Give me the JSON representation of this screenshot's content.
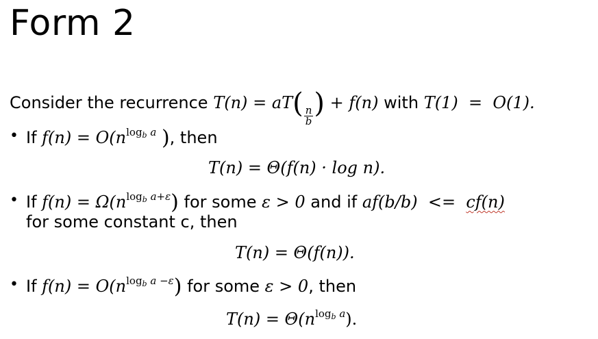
{
  "title": "Form 2",
  "intro": {
    "prefix": "Consider the recurrence",
    "recurrence_lhs": "T(n)",
    "eq": "=",
    "a": "a",
    "T": "T",
    "frac_num": "n",
    "frac_den": "b",
    "plus_f": "+ f(n)",
    "mid": "with",
    "base": "T(1)",
    "base_eq": "=",
    "base_rhs": "O(1)."
  },
  "cases": [
    {
      "bullet": "•",
      "if_text": "If",
      "f_expr": "f(n) = O(n",
      "sup": "log",
      "sup_sub": "b",
      "sup_tail": " a",
      "close": ")",
      "tail": ", then",
      "result": "T(n) = Θ(f(n) · log n)."
    },
    {
      "bullet": "•",
      "if_text": "If",
      "f_expr": "f(n) = Ω(n",
      "sup": "log",
      "sup_sub": "b",
      "sup_tail": " a+ε",
      "close": ")",
      "tail1": "for some",
      "eps_cond": "ε > 0",
      "tail2": "and if",
      "af": "af(b/b)",
      "le": "<=",
      "cfn": "cf(n)",
      "line2": "for some constant c, then",
      "result": "T(n) = Θ(f(n))."
    },
    {
      "bullet": "•",
      "if_text": "If",
      "f_expr": "f(n) = O(n",
      "sup": "log",
      "sup_sub": "b",
      "sup_tail": " a −ε",
      "close": ")",
      "tail1": "for some",
      "eps_cond": "ε > 0",
      "tail2": ", then",
      "result_prefix": "T(n) = Θ(n",
      "result_sup": "log",
      "result_sup_sub": "b",
      "result_sup_tail": " a",
      "result_suffix": ")."
    }
  ]
}
